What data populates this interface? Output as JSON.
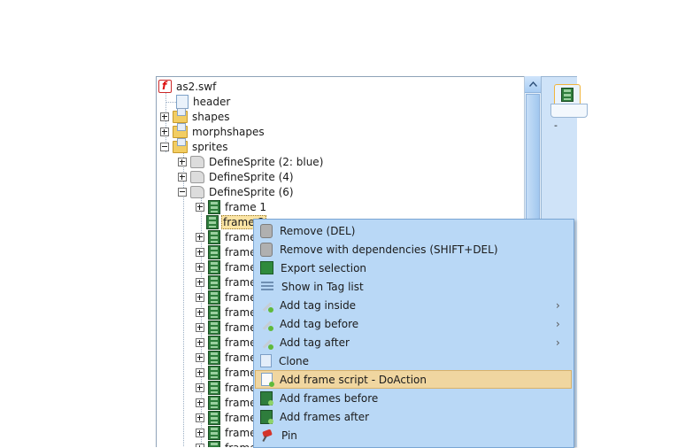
{
  "tree": {
    "nodes": [
      {
        "label": "as2.swf",
        "icon": "swf-file-icon"
      },
      {
        "label": "header",
        "icon": "document-icon"
      },
      {
        "label": "shapes",
        "icon": "folder-icon"
      },
      {
        "label": "morphshapes",
        "icon": "folder-icon"
      },
      {
        "label": "sprites",
        "icon": "folder-icon"
      },
      {
        "label": "DefineSprite (2: blue)",
        "icon": "sprite-icon"
      },
      {
        "label": "DefineSprite (4)",
        "icon": "sprite-icon"
      },
      {
        "label": "DefineSprite (6)",
        "icon": "sprite-icon"
      },
      {
        "label": "frame 1",
        "icon": "frame-icon"
      },
      {
        "label": "frame 2",
        "icon": "frame-icon"
      },
      {
        "label": "frame",
        "icon": "frame-icon"
      },
      {
        "label": "frame",
        "icon": "frame-icon"
      },
      {
        "label": "frame",
        "icon": "frame-icon"
      },
      {
        "label": "frame",
        "icon": "frame-icon"
      },
      {
        "label": "frame",
        "icon": "frame-icon"
      },
      {
        "label": "frame",
        "icon": "frame-icon"
      },
      {
        "label": "frame",
        "icon": "frame-icon"
      },
      {
        "label": "frame",
        "icon": "frame-icon"
      },
      {
        "label": "frame",
        "icon": "frame-icon"
      },
      {
        "label": "frame",
        "icon": "frame-icon"
      },
      {
        "label": "frame",
        "icon": "frame-icon"
      },
      {
        "label": "frame",
        "icon": "frame-icon"
      },
      {
        "label": "frame",
        "icon": "frame-icon"
      },
      {
        "label": "frame",
        "icon": "frame-icon"
      },
      {
        "label": "frame",
        "icon": "frame-icon"
      }
    ]
  },
  "right_panel": {
    "dash": "-"
  },
  "context_menu": {
    "items": [
      {
        "label": "Remove (DEL)",
        "icon": "remove-icon"
      },
      {
        "label": "Remove with dependencies (SHIFT+DEL)",
        "icon": "remove-icon"
      },
      {
        "label": "Export selection",
        "icon": "export-icon"
      },
      {
        "label": "Show in Tag list",
        "icon": "list-icon"
      },
      {
        "label": "Add tag inside",
        "icon": "add-tag-icon",
        "submenu": true
      },
      {
        "label": "Add tag before",
        "icon": "add-tag-icon",
        "submenu": true
      },
      {
        "label": "Add tag after",
        "icon": "add-tag-icon",
        "submenu": true
      },
      {
        "label": "Clone",
        "icon": "clone-icon"
      },
      {
        "label": "Add frame script - DoAction",
        "icon": "script-icon",
        "highlighted": true
      },
      {
        "label": "Add frames before",
        "icon": "frames-icon"
      },
      {
        "label": "Add frames after",
        "icon": "frames-icon"
      },
      {
        "label": "Pin",
        "icon": "pin-icon"
      }
    ]
  },
  "colors": {
    "menu_bg": "#b9d8f6",
    "highlight": "#f0d6a0",
    "selection": "#fbe4a4"
  }
}
